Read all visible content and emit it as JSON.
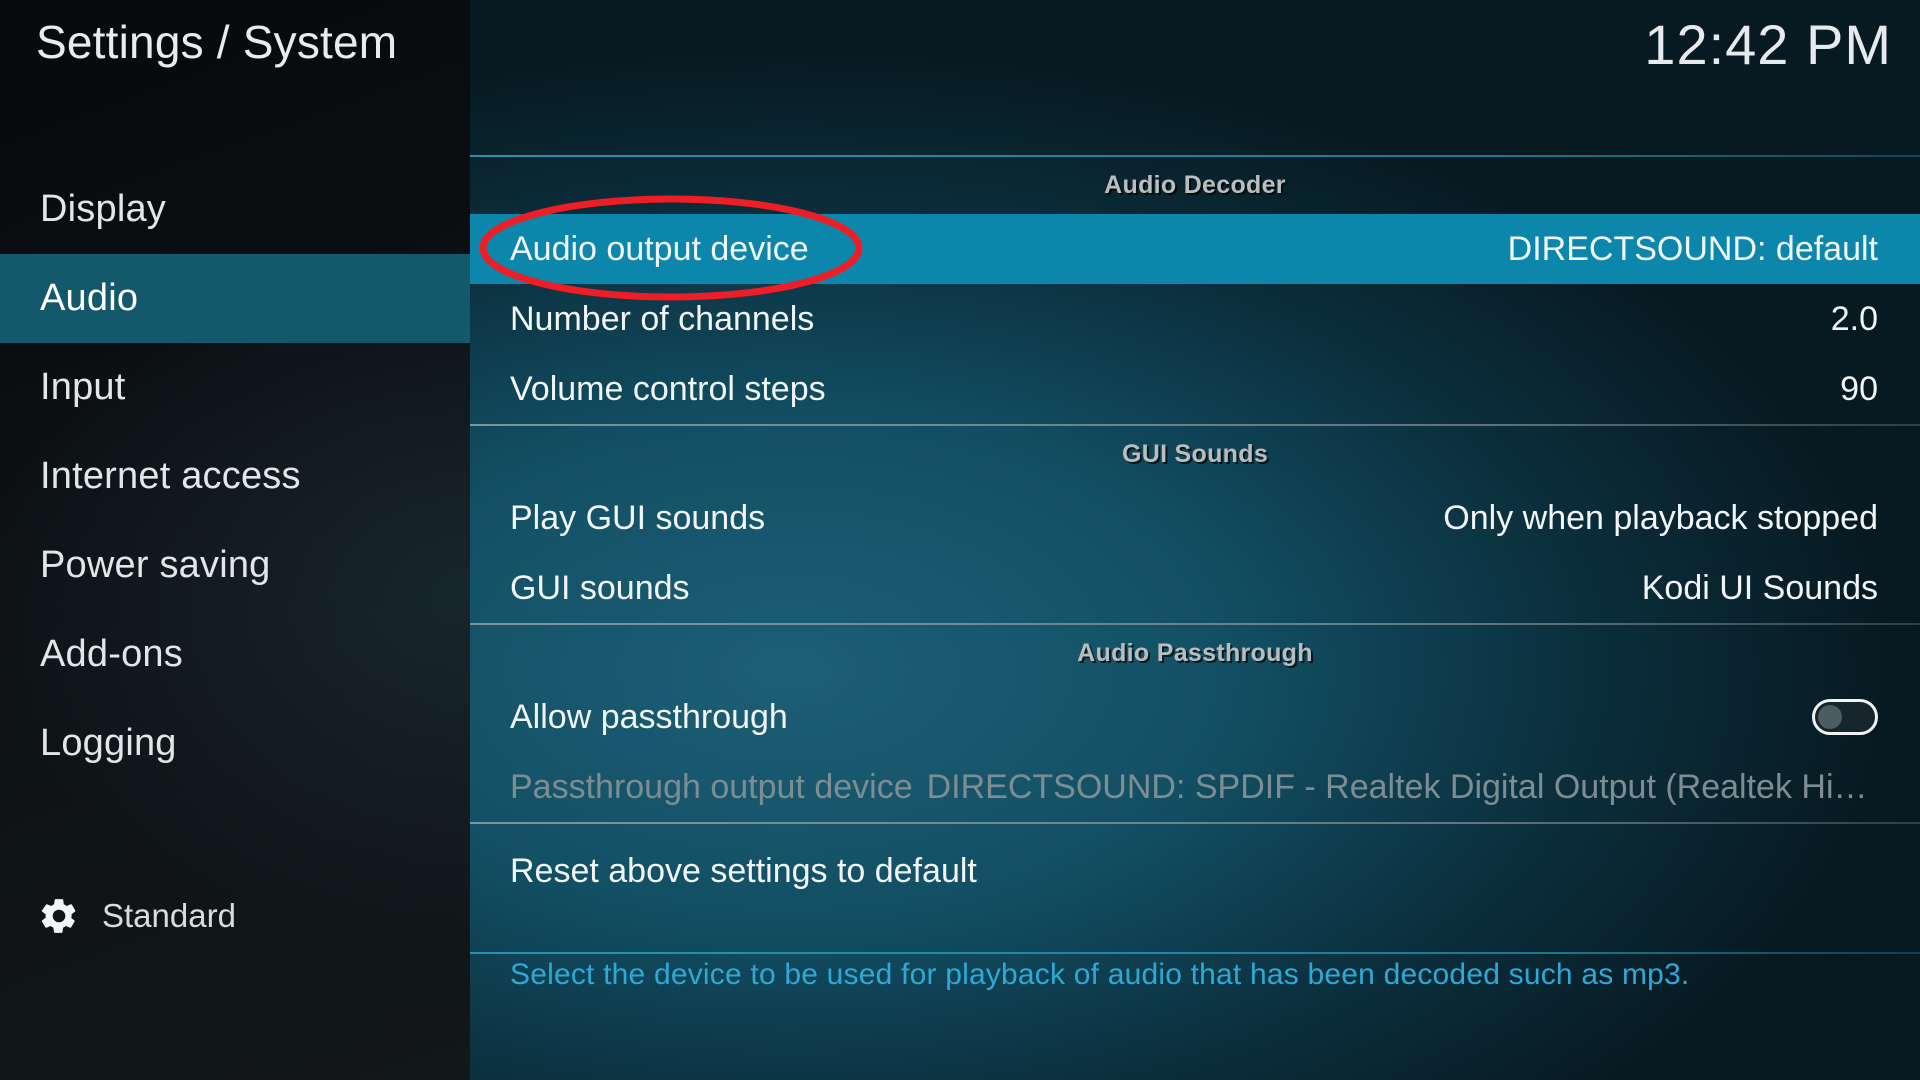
{
  "header": {
    "title": "Settings / System",
    "clock": "12:42 PM"
  },
  "sidebar": {
    "items": [
      {
        "label": "Display",
        "selected": false
      },
      {
        "label": "Audio",
        "selected": true
      },
      {
        "label": "Input",
        "selected": false
      },
      {
        "label": "Internet access",
        "selected": false
      },
      {
        "label": "Power saving",
        "selected": false
      },
      {
        "label": "Add-ons",
        "selected": false
      },
      {
        "label": "Logging",
        "selected": false
      }
    ],
    "profile": {
      "icon": "gear-icon",
      "label": "Standard"
    }
  },
  "main": {
    "groups": [
      {
        "title": "Audio Decoder",
        "rows": [
          {
            "label": "Audio output device",
            "value": "DIRECTSOUND: default",
            "state": "highlight",
            "control": "text"
          },
          {
            "label": "Number of channels",
            "value": "2.0",
            "state": "normal",
            "control": "text"
          },
          {
            "label": "Volume control steps",
            "value": "90",
            "state": "normal",
            "control": "text"
          }
        ]
      },
      {
        "title": "GUI Sounds",
        "rows": [
          {
            "label": "Play GUI sounds",
            "value": "Only when playback stopped",
            "state": "normal",
            "control": "text"
          },
          {
            "label": "GUI sounds",
            "value": "Kodi UI Sounds",
            "state": "normal",
            "control": "text"
          }
        ]
      },
      {
        "title": "Audio Passthrough",
        "rows": [
          {
            "label": "Allow passthrough",
            "value": "",
            "state": "normal",
            "control": "toggle",
            "toggle_on": false
          },
          {
            "label": "Passthrough output device",
            "value": "DIRECTSOUND: SPDIF - Realtek Digital Output (Realtek High Definition A...",
            "state": "disabled",
            "control": "text"
          }
        ]
      },
      {
        "title": "",
        "rows": [
          {
            "label": "Reset above settings to default",
            "value": "",
            "state": "normal",
            "control": "none"
          }
        ]
      }
    ]
  },
  "footer": {
    "help_text": "Select the device to be used for playback of audio that has been decoded such as mp3."
  },
  "annotation": {
    "shape": "ellipse",
    "color": "#ee1d26",
    "target": "Audio output device"
  },
  "colors": {
    "selected_nav": "#13586b",
    "highlight_row": "#0d86ab",
    "help_text": "#2fa8d6",
    "group_header": "#b9bdbd",
    "annotation_red": "#ee1d26"
  }
}
